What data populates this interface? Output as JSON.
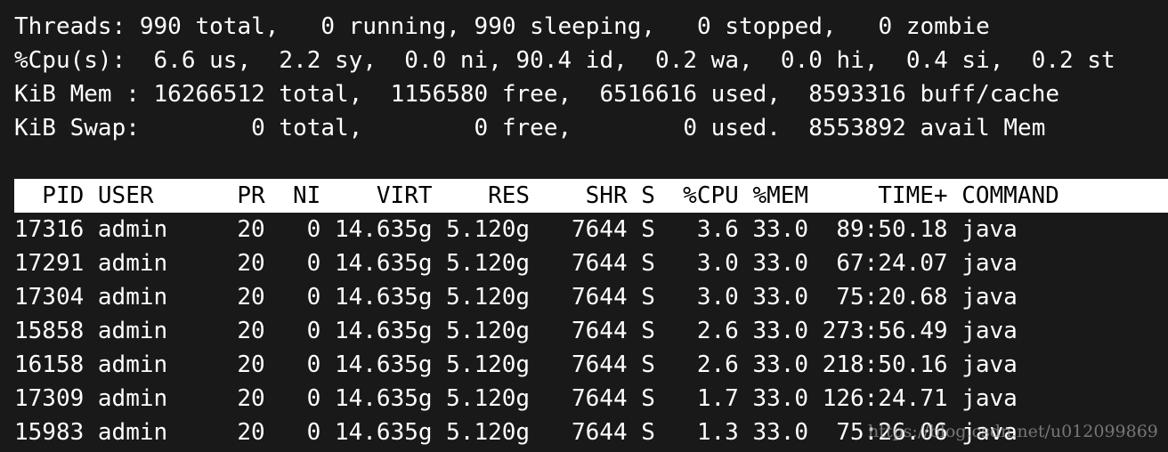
{
  "summary": [
    "Threads: 990 total,   0 running, 990 sleeping,   0 stopped,   0 zombie",
    "%Cpu(s):  6.6 us,  2.2 sy,  0.0 ni, 90.4 id,  0.2 wa,  0.0 hi,  0.4 si,  0.2 st",
    "KiB Mem : 16266512 total,  1156580 free,  6516616 used,  8593316 buff/cache",
    "KiB Swap:        0 total,        0 free,        0 used.  8553892 avail Mem"
  ],
  "table": {
    "columns": [
      "PID",
      "USER",
      "PR",
      "NI",
      "VIRT",
      "RES",
      "SHR",
      "S",
      "%CPU",
      "%MEM",
      "TIME+",
      "COMMAND"
    ],
    "rows": [
      [
        "17316",
        "admin",
        "20",
        "0",
        "14.635g",
        "5.120g",
        "7644",
        "S",
        "3.6",
        "33.0",
        "89:50.18",
        "java"
      ],
      [
        "17291",
        "admin",
        "20",
        "0",
        "14.635g",
        "5.120g",
        "7644",
        "S",
        "3.0",
        "33.0",
        "67:24.07",
        "java"
      ],
      [
        "17304",
        "admin",
        "20",
        "0",
        "14.635g",
        "5.120g",
        "7644",
        "S",
        "3.0",
        "33.0",
        "75:20.68",
        "java"
      ],
      [
        "15858",
        "admin",
        "20",
        "0",
        "14.635g",
        "5.120g",
        "7644",
        "S",
        "2.6",
        "33.0",
        "273:56.49",
        "java"
      ],
      [
        "16158",
        "admin",
        "20",
        "0",
        "14.635g",
        "5.120g",
        "7644",
        "S",
        "2.6",
        "33.0",
        "218:50.16",
        "java"
      ],
      [
        "17309",
        "admin",
        "20",
        "0",
        "14.635g",
        "5.120g",
        "7644",
        "S",
        "1.7",
        "33.0",
        "126:24.71",
        "java"
      ],
      [
        "15983",
        "admin",
        "20",
        "0",
        "14.635g",
        "5.120g",
        "7644",
        "S",
        "1.3",
        "33.0",
        "75:26.06",
        "java"
      ]
    ]
  },
  "watermark": "https://blog.csdn.net/u012099869",
  "colors": {
    "background": "#191919",
    "text": "#ffffff",
    "header_bg": "#ffffff",
    "header_text": "#000000"
  }
}
